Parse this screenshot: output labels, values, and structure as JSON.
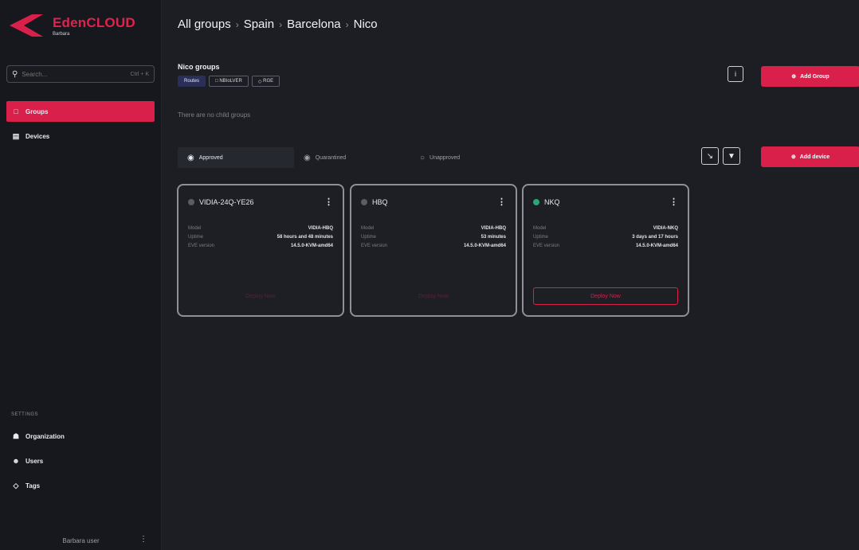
{
  "app": {
    "brand": "EdenCLOUD",
    "brand_sub": "Barbara"
  },
  "sidebar": {
    "search_placeholder": "Search...",
    "search_shortcut": "Ctrl + K",
    "items": [
      {
        "label": "Groups",
        "icon": "folder-icon",
        "active": true
      },
      {
        "label": "Devices",
        "icon": "devices-icon",
        "active": false
      }
    ],
    "settings_title": "SETTINGS",
    "settings_items": [
      {
        "label": "Organization",
        "icon": "organization-icon"
      },
      {
        "label": "Users",
        "icon": "users-icon"
      },
      {
        "label": "Tags",
        "icon": "tag-icon"
      }
    ],
    "footer_user": "Barbara user",
    "footer_menu": "⋮"
  },
  "breadcrumb": [
    "All groups",
    "Spain",
    "Barcelona",
    "Nico"
  ],
  "group": {
    "title": "Nico groups",
    "pills": [
      "Routes",
      "NBIoLVER",
      "RGE"
    ],
    "empty_text": "There are no child groups",
    "add_group_label": "Add Group",
    "info_label": "i"
  },
  "tabs": [
    {
      "label": "Approved",
      "active": true
    },
    {
      "label": "Quarantined",
      "active": false
    },
    {
      "label": "Unapproved",
      "active": false
    }
  ],
  "actions": {
    "add_device_label": "Add device",
    "select_icon": "cursor-icon",
    "filter_icon": "filter-icon"
  },
  "cards": [
    {
      "name": "VIDIA-24Q-YE26",
      "status": "offline",
      "status_color": "#5a5c66",
      "model_label": "Model",
      "model": "VIDIA-HBQ",
      "uptime_label": "Uptime",
      "uptime": "58 hours and 48 minutes",
      "eve_label": "EVE version",
      "eve": "14.5.0-KVM-amd64",
      "button": "Deploy Now",
      "button_enabled": false
    },
    {
      "name": "HBQ",
      "status": "offline",
      "status_color": "#5a5c66",
      "model_label": "Model",
      "model": "VIDIA-HBQ",
      "uptime_label": "Uptime",
      "uptime": "53 minutes",
      "eve_label": "EVE version",
      "eve": "14.5.0-KVM-amd64",
      "button": "Deploy Now",
      "button_enabled": false
    },
    {
      "name": "NKQ",
      "status": "online",
      "status_color": "#2aa871",
      "model_label": "Model",
      "model": "VIDIA-NKQ",
      "uptime_label": "Uptime",
      "uptime": "3 days and 17 hours",
      "eve_label": "EVE version",
      "eve": "14.5.0-KVM-amd64",
      "button": "Deploy Now",
      "button_enabled": true
    }
  ],
  "colors": {
    "accent": "#d8204b",
    "background": "#1c1e24",
    "sidebar": "#17181d"
  }
}
